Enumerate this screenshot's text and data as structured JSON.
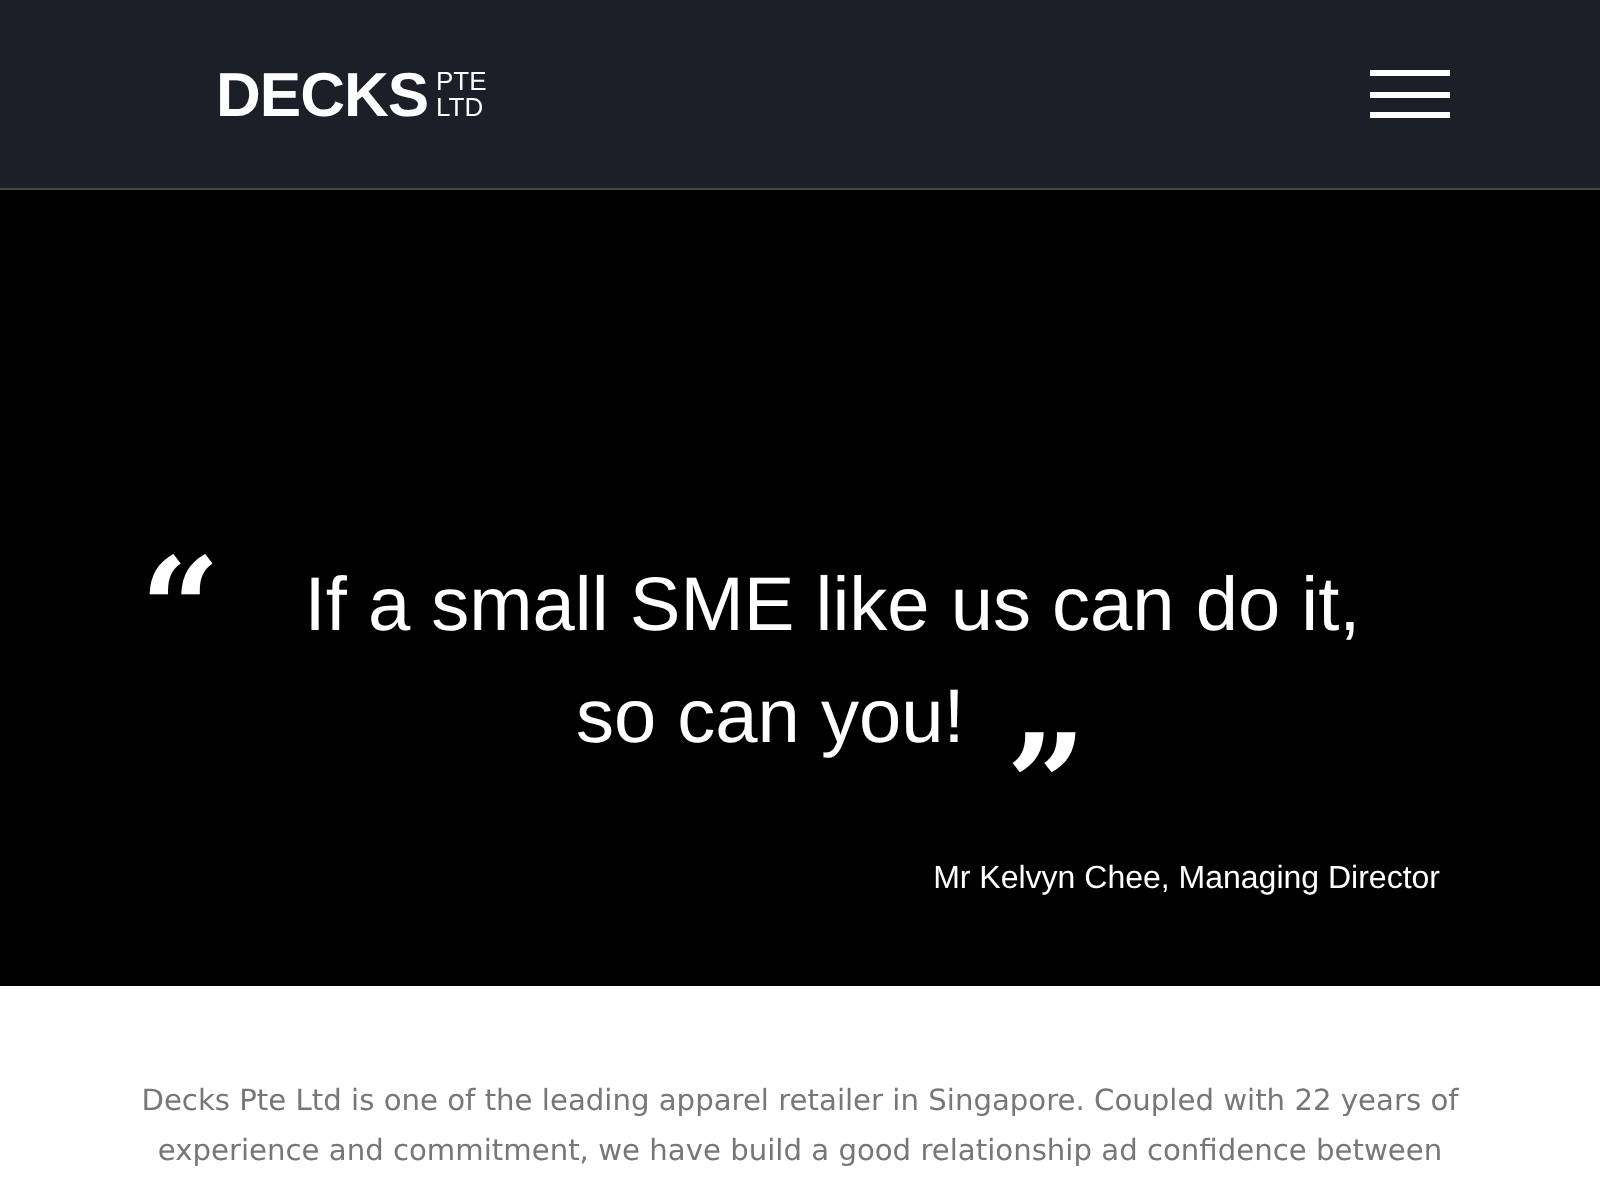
{
  "header": {
    "logo": {
      "name": "DECKS",
      "suffix_top": "PTE",
      "suffix_bottom": "LTD"
    }
  },
  "hero": {
    "open_quote": "“",
    "quote_lines": [
      "If a small SME like us can do it,",
      "so can you!"
    ],
    "close_quote": "„",
    "attribution": "Mr Kelvyn Chee, Managing Director"
  },
  "intro": {
    "text": "Decks Pte Ltd is one of the leading apparel retailer in Singapore. Coupled with 22 years of experience and commitment, we have build a good relationship ad confidence between"
  }
}
